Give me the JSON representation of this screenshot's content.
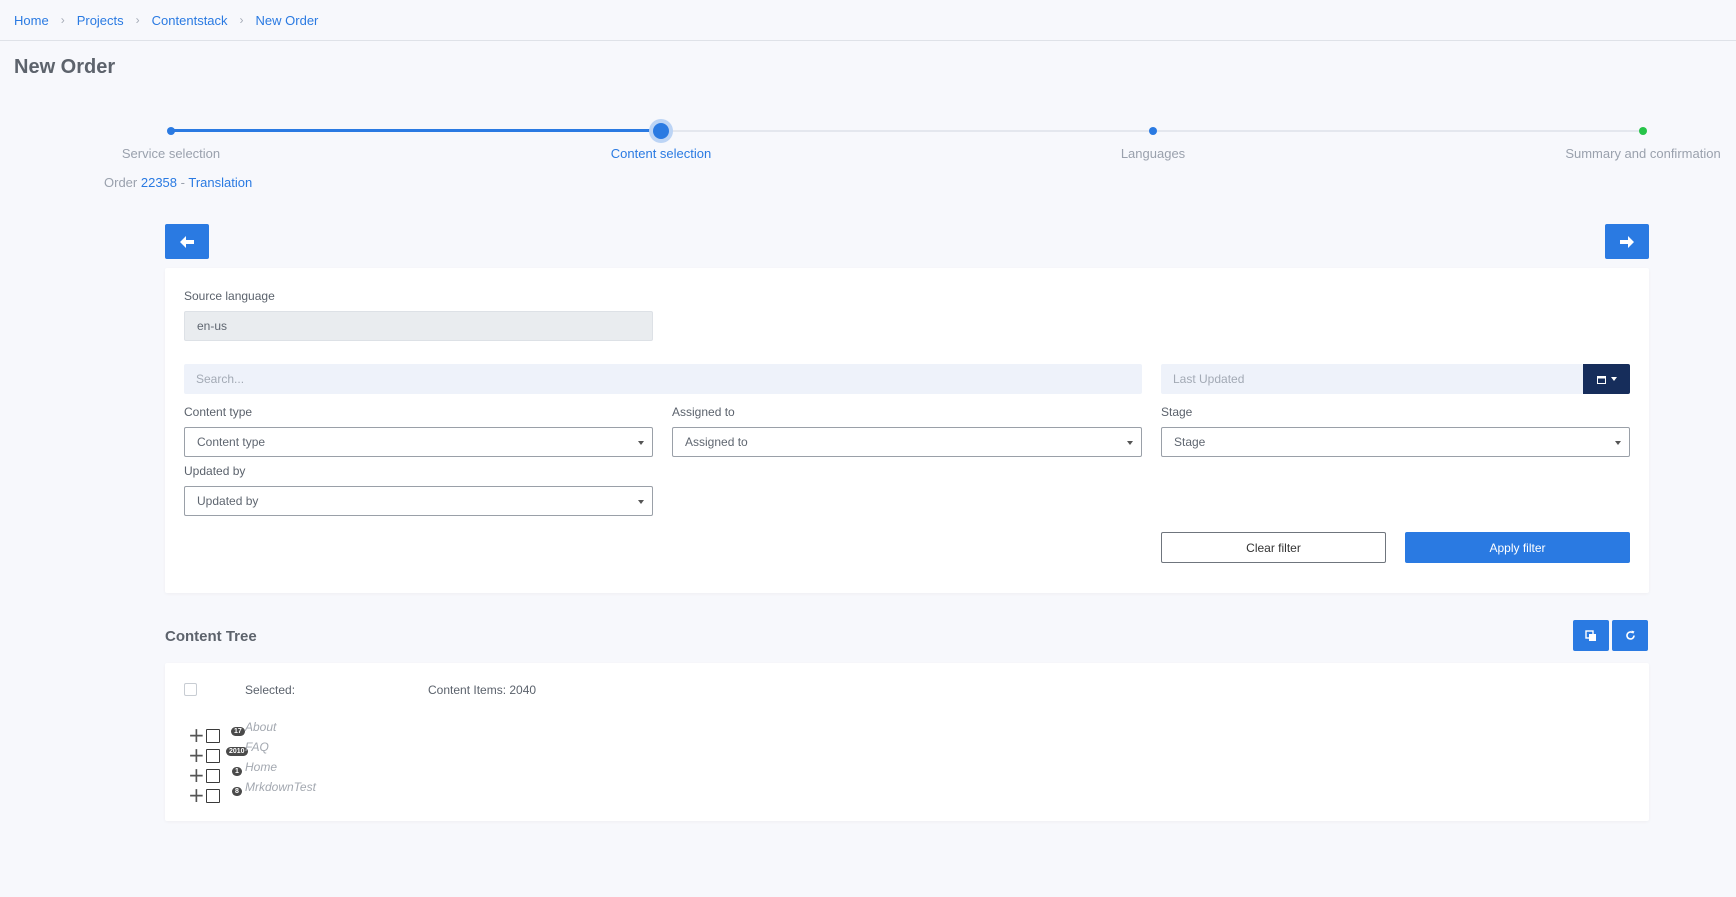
{
  "breadcrumb": [
    "Home",
    "Projects",
    "Contentstack",
    "New Order"
  ],
  "page_title": "New Order",
  "steps": [
    "Service selection",
    "Content selection",
    "Languages",
    "Summary and confirmation"
  ],
  "order": {
    "prefix": "Order",
    "number": "22358",
    "dash": "-",
    "type": "Translation"
  },
  "filters": {
    "source_language_label": "Source language",
    "source_language_value": "en-us",
    "search_placeholder": "Search...",
    "last_updated_placeholder": "Last Updated",
    "content_type_label": "Content type",
    "content_type_value": "Content type",
    "assigned_to_label": "Assigned to",
    "assigned_to_value": "Assigned to",
    "stage_label": "Stage",
    "stage_value": "Stage",
    "updated_by_label": "Updated by",
    "updated_by_value": "Updated by",
    "clear_label": "Clear filter",
    "apply_label": "Apply filter"
  },
  "content_tree": {
    "title": "Content Tree",
    "selected_label": "Selected:",
    "items_label": "Content Items: 2040",
    "items": [
      {
        "count": "17",
        "name": "About"
      },
      {
        "count": "2010",
        "name": "FAQ"
      },
      {
        "count": "1",
        "name": "Home"
      },
      {
        "count": "8",
        "name": "MrkdownTest"
      }
    ]
  },
  "icons": {
    "back": "arrow-left-icon",
    "next": "arrow-right-icon",
    "calendar": "calendar-icon",
    "copy": "copy-icon",
    "refresh": "refresh-icon"
  },
  "colors": {
    "primary": "#2a7ae2",
    "dark": "#162d5b",
    "success": "#27c449"
  }
}
